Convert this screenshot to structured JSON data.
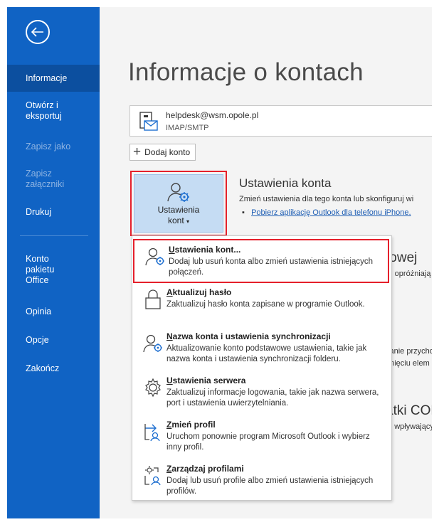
{
  "nav": {
    "items": [
      {
        "label": "Informacje",
        "active": true
      },
      {
        "label": "Otwórz i\neksportuj"
      },
      {
        "label": "Zapisz jako",
        "disabled": true
      },
      {
        "label": "Zapisz\nzałączniki",
        "disabled": true
      },
      {
        "label": "Drukuj"
      },
      {
        "label": "Konto\npakietu\nOffice"
      },
      {
        "label": "Opinia"
      },
      {
        "label": "Opcje"
      },
      {
        "label": "Zakończ"
      }
    ]
  },
  "page": {
    "title": "Informacje o kontach"
  },
  "account": {
    "email": "helpdesk@wsm.opole.pl",
    "type": "IMAP/SMTP"
  },
  "add_account": {
    "label": "Dodaj konto"
  },
  "settings_tile": {
    "line1": "Ustawienia",
    "line2": "kont"
  },
  "account_settings": {
    "heading": "Ustawienia konta",
    "desc": "Zmień ustawienia dla tego konta lub skonfiguruj wi",
    "link": "Pobierz aplikację Outlook dla telefonu iPhone,"
  },
  "partial": {
    "heading2": "towej",
    "text2": "ej, opróżniają",
    "text3a": "vanie przycho",
    "text3b": "unięciu elem",
    "heading4": "atki CON",
    "text4": "M wpływający"
  },
  "menu": {
    "items": [
      {
        "first": "U",
        "rest": "stawienia kont...",
        "desc": "Dodaj lub usuń konta albo zmień ustawienia istniejących połączeń."
      },
      {
        "first": "A",
        "rest": "ktualizuj hasło",
        "desc": "Zaktualizuj hasło konta zapisane w programie Outlook."
      },
      {
        "first": "N",
        "rest": "azwa konta i ustawienia synchronizacji",
        "desc": "Aktualizowanie konto podstawowe ustawienia, takie jak nazwa konta i ustawienia synchronizacji folderu."
      },
      {
        "first": "U",
        "rest": "stawienia serwera",
        "desc": "Zaktualizuj informacje logowania, takie jak nazwa serwera, port i ustawienia uwierzytelniania."
      },
      {
        "first": "Z",
        "rest": "mień profil",
        "desc": "Uruchom ponownie program Microsoft Outlook i wybierz inny profil."
      },
      {
        "first": "Z",
        "rest": "arządzaj profilami",
        "desc": "Dodaj lub usuń profile albo zmień ustawienia istniejących profilów."
      }
    ]
  },
  "colors": {
    "nav_bg": "#1063c4",
    "nav_active": "#0c4f9f",
    "highlight_border": "#e5202b",
    "tile_bg": "#c5dcf3",
    "link": "#1e5eb4"
  }
}
